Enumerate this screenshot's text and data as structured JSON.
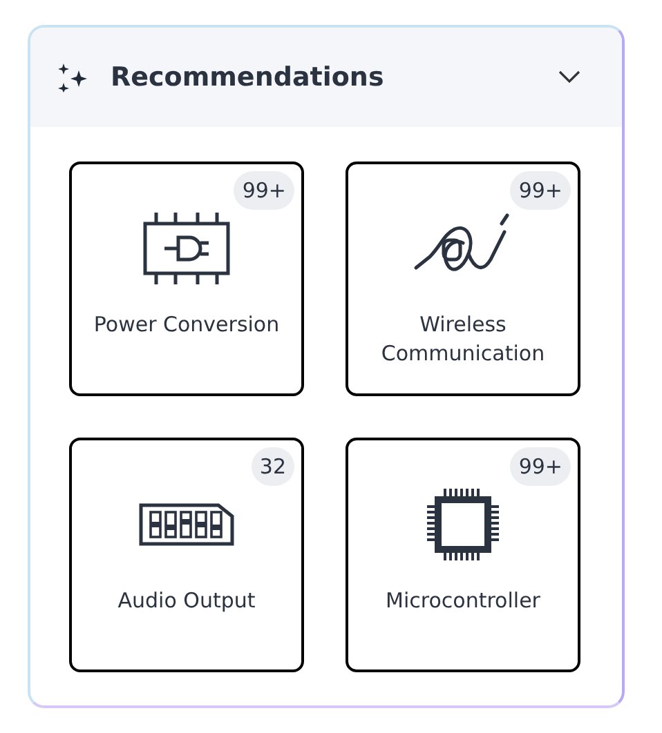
{
  "panel": {
    "title": "Recommendations",
    "expanded": true
  },
  "cards": [
    {
      "kind": "power",
      "label": "Power Conversion",
      "count": "99+"
    },
    {
      "kind": "cable",
      "label": "Wireless Communication",
      "count": "99+"
    },
    {
      "kind": "switch",
      "label": "Audio Output",
      "count": "32"
    },
    {
      "kind": "chip",
      "label": "Microcontroller",
      "count": "99+"
    }
  ]
}
